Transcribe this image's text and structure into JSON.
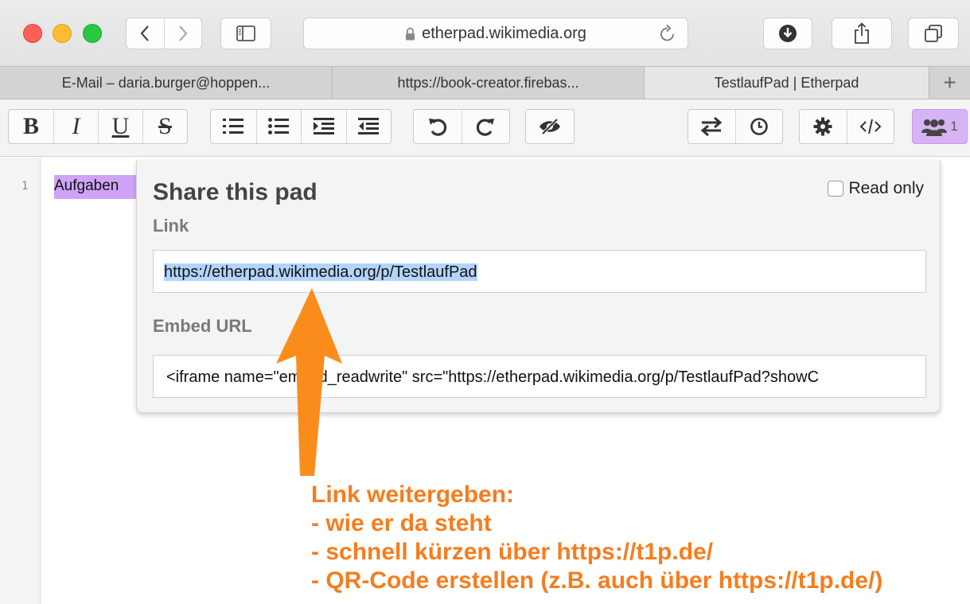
{
  "browser": {
    "address": "etherpad.wikimedia.org",
    "tabs": [
      "E-Mail – daria.burger@hoppen...",
      "https://book-creator.firebas...",
      "TestlaufPad | Etherpad"
    ],
    "new_tab": "+"
  },
  "toolbar": {
    "bold": "B",
    "italic": "I",
    "underline": "U",
    "strike": "S",
    "users_count": "1"
  },
  "editor": {
    "line_number": "1",
    "line_text": "Aufgaben"
  },
  "share_popup": {
    "title": "Share this pad",
    "read_only_label": "Read only",
    "link_label": "Link",
    "link_value": "https://etherpad.wikimedia.org/p/TestlaufPad",
    "embed_label": "Embed URL",
    "embed_value": "<iframe name=\"embed_readwrite\" src=\"https://etherpad.wikimedia.org/p/TestlaufPad?showC"
  },
  "annotation": {
    "color": "#f57d1e",
    "lines": [
      "Link weitergeben:",
      "- wie er da steht",
      "- schnell kürzen über https://t1p.de/",
      "- QR-Code erstellen (z.B. auch über https://t1p.de/)"
    ]
  },
  "colors": {
    "users_button": "#d7b3f3",
    "line_highlight": "#cfa3f8",
    "link_selection": "#b3d4fc"
  }
}
